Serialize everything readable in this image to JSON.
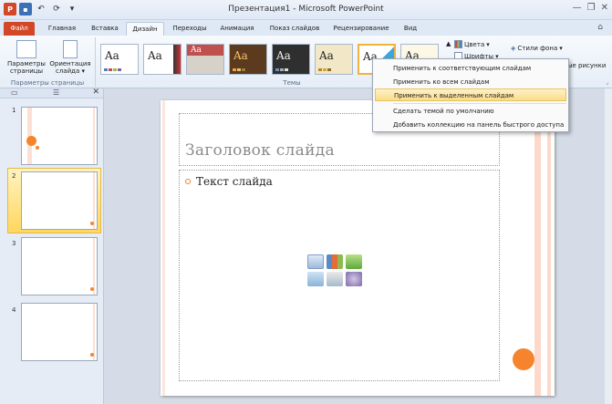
{
  "window": {
    "title": "Презентация1 - Microsoft PowerPoint",
    "app_logo": "P",
    "qat_undo": "↶",
    "qat_redo": "⟳",
    "qat_more": "▾",
    "minimize": "—",
    "restore": "❐",
    "close": "✕"
  },
  "tabs": [
    {
      "label": "Файл"
    },
    {
      "label": "Главная"
    },
    {
      "label": "Вставка"
    },
    {
      "label": "Дизайн"
    },
    {
      "label": "Переходы"
    },
    {
      "label": "Анимация"
    },
    {
      "label": "Показ слайдов"
    },
    {
      "label": "Рецензирование"
    },
    {
      "label": "Вид"
    }
  ],
  "ribbon": {
    "page_setup_label": "Параметры страницы",
    "orientation_label": "Ориентация слайда",
    "orientation_arrow": "▾",
    "group_page_setup": "Параметры страницы",
    "group_themes": "Темы",
    "theme_aa": "Aa",
    "colors": "Цвета",
    "fonts": "Шрифты",
    "bg_styles": "Стили фона",
    "hide_bg": "ые рисунки"
  },
  "context_menu": {
    "items": [
      {
        "label": "Применить к соответствующим слайдам"
      },
      {
        "label": "Применить ко всем слайдам"
      },
      {
        "label": "Применить к выделенным слайдам"
      },
      {
        "label": "Сделать темой по умолчанию"
      },
      {
        "label": "Добавить коллекцию на панель быстрого доступа"
      }
    ]
  },
  "thumbnails": [
    {
      "num": "1"
    },
    {
      "num": "2"
    },
    {
      "num": "3"
    },
    {
      "num": "4"
    }
  ],
  "slide": {
    "title": "Заголовок слайда",
    "body": "Текст слайда"
  },
  "colors": {
    "accent": "#f5842d",
    "file_tab": "#d24726",
    "highlight": "#fbdd86"
  }
}
